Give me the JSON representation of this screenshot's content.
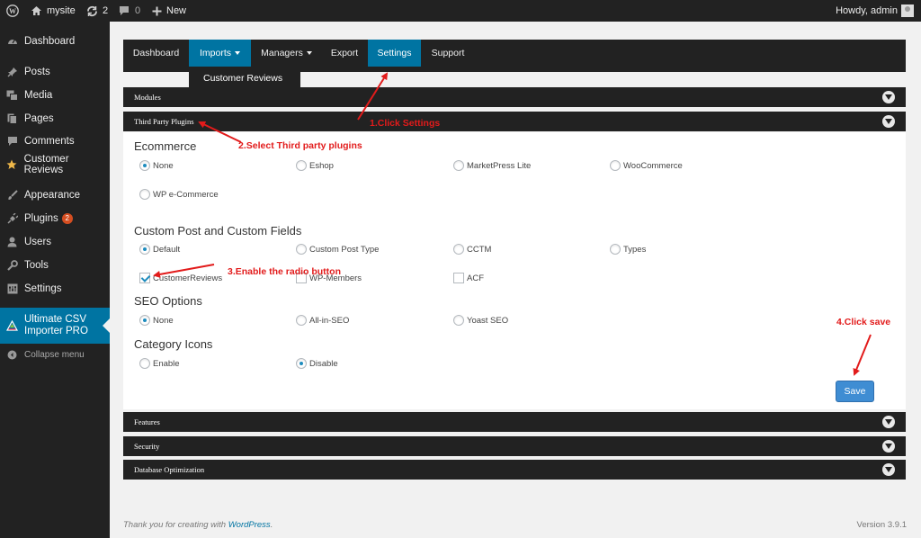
{
  "adminbar": {
    "site_name": "mysite",
    "updates_count": "2",
    "comments_count": "0",
    "new_label": "New",
    "howdy": "Howdy, admin"
  },
  "sidebar": {
    "items": [
      {
        "label": "Dashboard",
        "icon": "dashboard-icon"
      },
      {
        "label": "Posts",
        "icon": "pin-icon"
      },
      {
        "label": "Media",
        "icon": "media-icon"
      },
      {
        "label": "Pages",
        "icon": "pages-icon"
      },
      {
        "label": "Comments",
        "icon": "comment-icon"
      },
      {
        "label": "Customer Reviews",
        "icon": "star-icon"
      },
      {
        "label": "Appearance",
        "icon": "brush-icon"
      },
      {
        "label": "Plugins",
        "icon": "plug-icon",
        "badge": "2"
      },
      {
        "label": "Users",
        "icon": "user-icon"
      },
      {
        "label": "Tools",
        "icon": "wrench-icon"
      },
      {
        "label": "Settings",
        "icon": "settings-icon"
      },
      {
        "label": "Ultimate CSV\nImporter PRO",
        "icon": "csv-importer-icon"
      }
    ],
    "collapse_label": "Collapse menu"
  },
  "topnav": {
    "items": [
      "Dashboard",
      "Imports",
      "Managers",
      "Export",
      "Settings",
      "Support"
    ],
    "dropdown_item": "Customer Reviews"
  },
  "accordion": {
    "modules": "Modules",
    "third_party": "Third Party Plugins",
    "features": "Features",
    "security": "Security",
    "database": "Database Optimization"
  },
  "ecommerce": {
    "title": "Ecommerce",
    "options": [
      "None",
      "Eshop",
      "MarketPress Lite",
      "WooCommerce",
      "WP e-Commerce"
    ],
    "selected": "None"
  },
  "custom_post": {
    "title": "Custom Post and Custom Fields",
    "radio_options": [
      "Default",
      "Custom Post Type",
      "CCTM",
      "Types"
    ],
    "selected": "Default",
    "checkbox_options": [
      {
        "label": "CustomerReviews",
        "checked": true
      },
      {
        "label": "WP-Members",
        "checked": false
      },
      {
        "label": "ACF",
        "checked": false
      }
    ]
  },
  "seo": {
    "title": "SEO Options",
    "options": [
      "None",
      "All-in-SEO",
      "Yoast SEO"
    ],
    "selected": "None"
  },
  "category_icons": {
    "title": "Category Icons",
    "options": [
      "Enable",
      "Disable"
    ],
    "selected": "Disable"
  },
  "save_label": "Save",
  "annotations": {
    "a1": "1.Click Settings",
    "a2": "2.Select Third party plugins",
    "a3": "3.Enable the radio button",
    "a4": "4.Click save"
  },
  "footer": {
    "thanks_prefix": "Thank you for creating with ",
    "thanks_link": "WordPress",
    "thanks_suffix": ".",
    "version": "Version 3.9.1"
  },
  "colors": {
    "accent": "#0074a2",
    "annotation": "#e21b1b",
    "admin_bar": "#222222"
  }
}
